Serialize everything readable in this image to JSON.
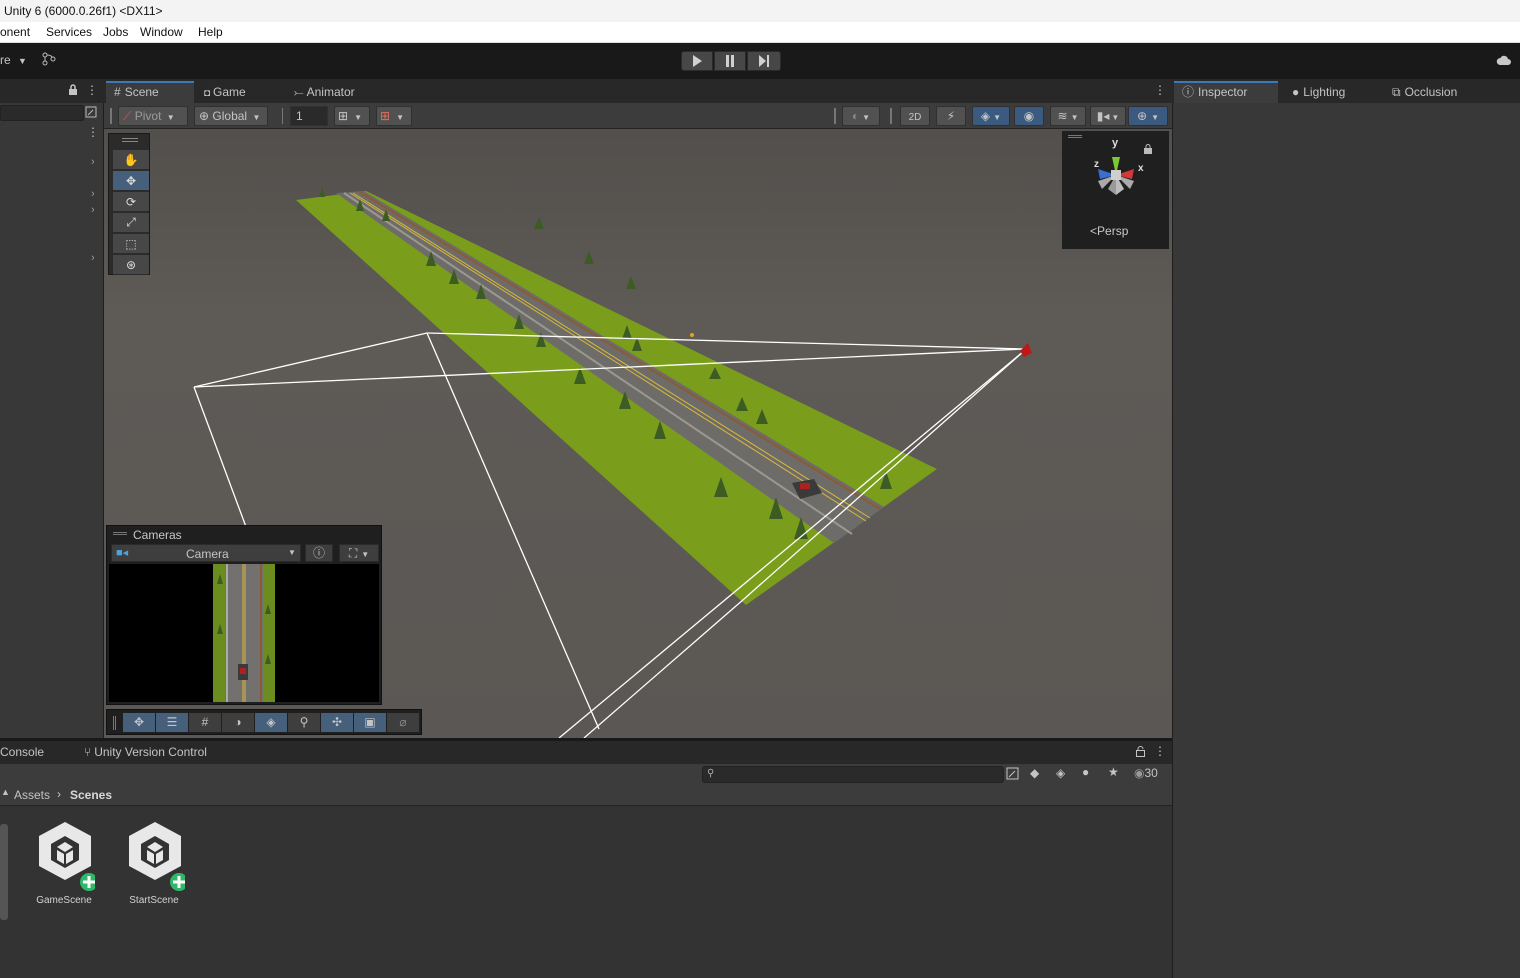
{
  "window": {
    "title": "Unity 6 (6000.0.26f1) <DX11>"
  },
  "menu": {
    "items": [
      "onent",
      "Services",
      "Jobs",
      "Window",
      "Help"
    ]
  },
  "toolbar": {
    "account_label": "re"
  },
  "scene_tabs": [
    {
      "label": "Scene",
      "icon": "grid-icon"
    },
    {
      "label": "Game",
      "icon": "gamepad-icon"
    },
    {
      "label": "Animator",
      "icon": "animator-icon"
    }
  ],
  "scene_toolbar": {
    "pivot": "Pivot",
    "global": "Global",
    "snap_value": "1"
  },
  "gizmo": {
    "y": "y",
    "x": "x",
    "z": "z",
    "projection": "Persp"
  },
  "cameras_overlay": {
    "title": "Cameras",
    "selected": "Camera"
  },
  "right_tabs": [
    {
      "label": "Inspector",
      "icon": "info-icon"
    },
    {
      "label": "Lighting",
      "icon": "bulb-icon"
    },
    {
      "label": "Occlusion",
      "icon": "occlusion-icon"
    }
  ],
  "bottom_tabs": [
    {
      "label": "Console"
    },
    {
      "label": "Unity Version Control"
    }
  ],
  "project": {
    "search_placeholder": "",
    "visible_count": "30",
    "breadcrumb": [
      "Assets",
      "Scenes"
    ],
    "assets": [
      {
        "name": "GameScene"
      },
      {
        "name": "StartScene"
      }
    ]
  },
  "colors": {
    "accent": "#3a79bb",
    "ground": "#7a9e1c",
    "panel": "#383838"
  }
}
